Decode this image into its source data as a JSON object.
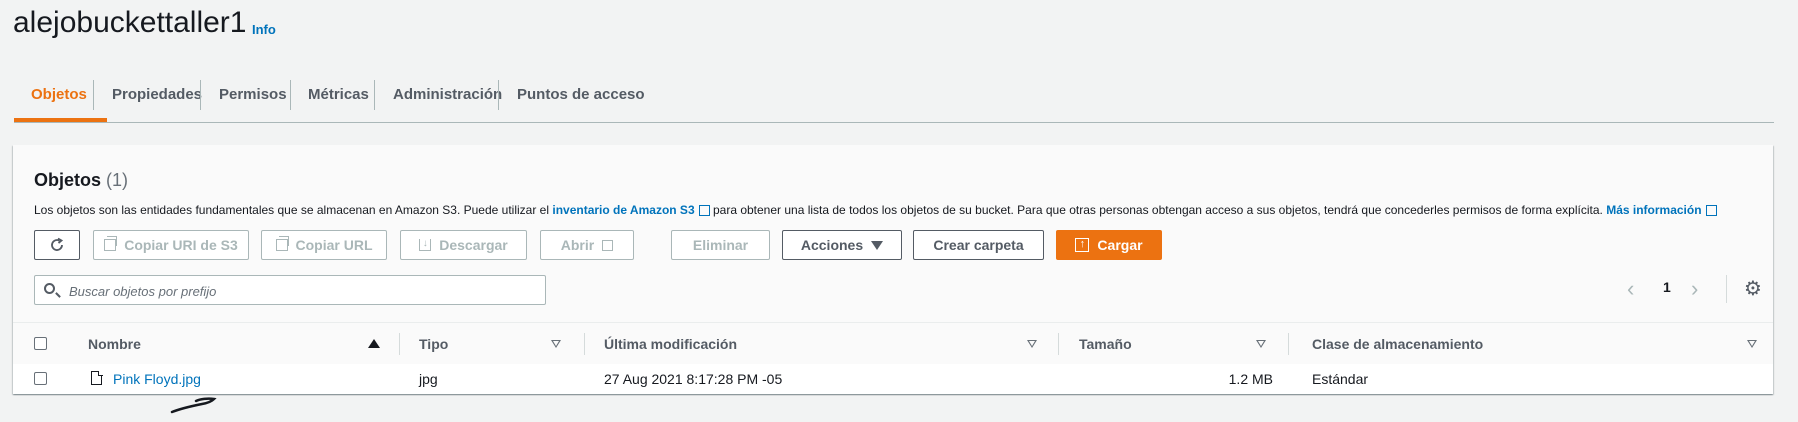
{
  "bucket": {
    "name": "alejobuckettaller1",
    "info_label": "Info"
  },
  "tabs": [
    {
      "label": "Objetos",
      "active": true
    },
    {
      "label": "Propiedades"
    },
    {
      "label": "Permisos"
    },
    {
      "label": "Métricas"
    },
    {
      "label": "Administración"
    },
    {
      "label": "Puntos de acceso"
    }
  ],
  "objects_panel": {
    "heading": "Objetos",
    "count": "(1)",
    "description_1": "Los objetos son las entidades fundamentales que se almacenan en Amazon S3. Puede utilizar el",
    "description_link": "inventario de Amazon S3",
    "description_2": "para obtener una lista de todos los objetos de su bucket. Para que otras personas obtengan acceso a sus objetos, tendrá que concederles permisos de forma explícita.",
    "more_info_link": "Más información"
  },
  "toolbar": {
    "refresh_icon": "refresh-icon",
    "copy_s3_uri": "Copiar URI de S3",
    "copy_url": "Copiar URL",
    "download": "Descargar",
    "open": "Abrir",
    "delete": "Eliminar",
    "actions": "Acciones",
    "create_folder": "Crear carpeta",
    "upload": "Cargar"
  },
  "search": {
    "placeholder": "Buscar objetos por prefijo",
    "value": ""
  },
  "pagination": {
    "current_page": "1"
  },
  "table": {
    "columns": [
      "Nombre",
      "Tipo",
      "Última modificación",
      "Tamaño",
      "Clase de almacenamiento"
    ],
    "rows": [
      {
        "name": "Pink Floyd.jpg",
        "type": "jpg",
        "modified": "27 Aug 2021 8:17:28 PM -05",
        "size": "1.2 MB",
        "storage_class": "Estándar"
      }
    ]
  },
  "colors": {
    "accent": "#ec7211",
    "link": "#0073bb",
    "text": "#16191f",
    "muted": "#545b64"
  }
}
